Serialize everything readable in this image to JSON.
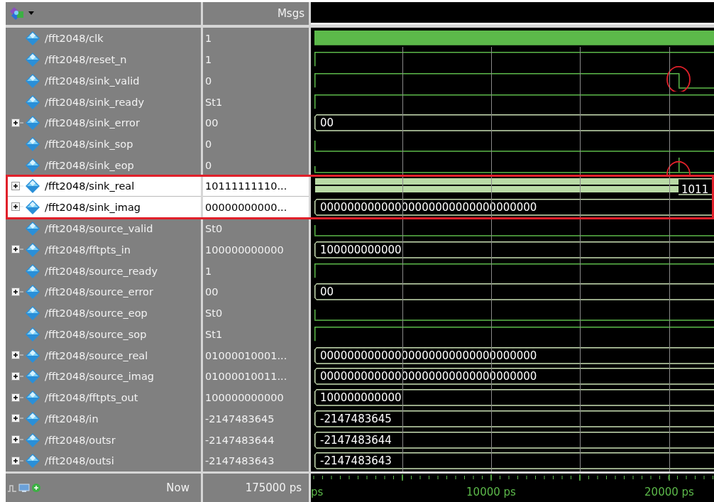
{
  "header": {
    "value_column": "Msgs"
  },
  "signals": [
    {
      "name": "/fft2048/clk",
      "value": "1",
      "expandable": false,
      "selected": false,
      "highlighted": false,
      "circled": false,
      "kind": "clock"
    },
    {
      "name": "/fft2048/reset_n",
      "value": "1",
      "expandable": false,
      "selected": false,
      "highlighted": false,
      "circled": false,
      "kind": "high"
    },
    {
      "name": "/fft2048/sink_valid",
      "value": "0",
      "expandable": false,
      "selected": false,
      "highlighted": false,
      "circled": true,
      "kind": "fall"
    },
    {
      "name": "/fft2048/sink_ready",
      "value": "St1",
      "expandable": false,
      "selected": false,
      "highlighted": false,
      "circled": false,
      "kind": "high"
    },
    {
      "name": "/fft2048/sink_error",
      "value": "00",
      "expandable": true,
      "selected": false,
      "highlighted": false,
      "circled": false,
      "kind": "bus",
      "wave_label": "00"
    },
    {
      "name": "/fft2048/sink_sop",
      "value": "0",
      "expandable": false,
      "selected": false,
      "highlighted": false,
      "circled": false,
      "kind": "low"
    },
    {
      "name": "/fft2048/sink_eop",
      "value": "0",
      "expandable": false,
      "selected": false,
      "highlighted": false,
      "circled": true,
      "kind": "pulse"
    },
    {
      "name": "/fft2048/sink_real",
      "value": "10111111110...",
      "expandable": true,
      "selected": true,
      "highlighted": true,
      "circled": false,
      "kind": "busy",
      "wave_label": "1011"
    },
    {
      "name": "/fft2048/sink_imag",
      "value": "00000000000...",
      "expandable": true,
      "selected": true,
      "highlighted": true,
      "circled": false,
      "kind": "bus",
      "wave_label": "00000000000000000000000000000000"
    },
    {
      "name": "/fft2048/source_valid",
      "value": "St0",
      "expandable": false,
      "selected": false,
      "highlighted": false,
      "circled": false,
      "kind": "low"
    },
    {
      "name": "/fft2048/fftpts_in",
      "value": "100000000000",
      "expandable": true,
      "selected": false,
      "highlighted": false,
      "circled": false,
      "kind": "bus",
      "wave_label": "100000000000"
    },
    {
      "name": "/fft2048/source_ready",
      "value": "1",
      "expandable": false,
      "selected": false,
      "highlighted": false,
      "circled": false,
      "kind": "high"
    },
    {
      "name": "/fft2048/source_error",
      "value": "00",
      "expandable": true,
      "selected": false,
      "highlighted": false,
      "circled": false,
      "kind": "bus",
      "wave_label": "00"
    },
    {
      "name": "/fft2048/source_eop",
      "value": "St0",
      "expandable": false,
      "selected": false,
      "highlighted": false,
      "circled": false,
      "kind": "low"
    },
    {
      "name": "/fft2048/source_sop",
      "value": "St1",
      "expandable": false,
      "selected": false,
      "highlighted": false,
      "circled": false,
      "kind": "high"
    },
    {
      "name": "/fft2048/source_real",
      "value": "01000010001...",
      "expandable": true,
      "selected": false,
      "highlighted": false,
      "circled": false,
      "kind": "bus",
      "wave_label": "00000000000000000000000000000000"
    },
    {
      "name": "/fft2048/source_imag",
      "value": "01000010011...",
      "expandable": true,
      "selected": false,
      "highlighted": false,
      "circled": false,
      "kind": "bus",
      "wave_label": "00000000000000000000000000000000"
    },
    {
      "name": "/fft2048/fftpts_out",
      "value": "100000000000",
      "expandable": true,
      "selected": false,
      "highlighted": false,
      "circled": false,
      "kind": "bus",
      "wave_label": "100000000000"
    },
    {
      "name": "/fft2048/in",
      "value": "-2147483645",
      "expandable": true,
      "selected": false,
      "highlighted": false,
      "circled": false,
      "kind": "bus",
      "wave_label": "-2147483645"
    },
    {
      "name": "/fft2048/outsr",
      "value": "-2147483644",
      "expandable": true,
      "selected": false,
      "highlighted": false,
      "circled": false,
      "kind": "bus",
      "wave_label": "-2147483644"
    },
    {
      "name": "/fft2048/outsi",
      "value": "-2147483643",
      "expandable": true,
      "selected": false,
      "highlighted": false,
      "circled": false,
      "kind": "bus",
      "wave_label": "-2147483643"
    }
  ],
  "footer": {
    "label": "Now",
    "time": "175000 ps",
    "axis_labels": [
      "ps",
      "10000 ps",
      "20000 ps"
    ]
  }
}
